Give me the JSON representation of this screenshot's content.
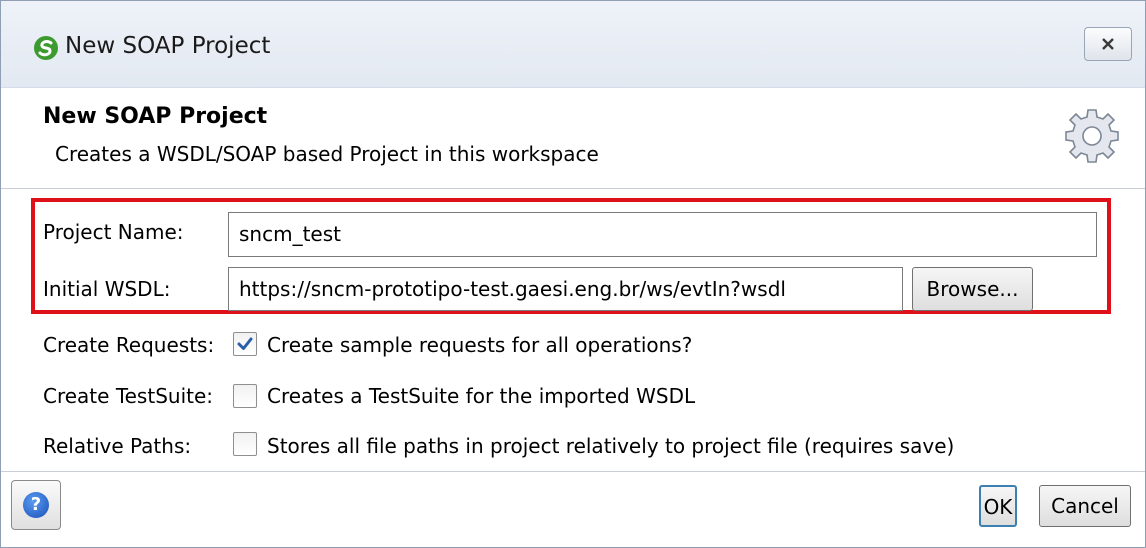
{
  "window": {
    "title": "New SOAP Project",
    "close_icon": "close-icon",
    "app_icon": "soapui-icon"
  },
  "header": {
    "title": "New SOAP Project",
    "subtitle": "Creates a WSDL/SOAP based Project in this workspace",
    "icon": "gear-icon"
  },
  "form": {
    "project_name": {
      "label": "Project Name:",
      "value": "sncm_test"
    },
    "initial_wsdl": {
      "label": "Initial WSDL:",
      "value": "https://sncm-prototipo-test.gaesi.eng.br/ws/evtIn?wsdl",
      "browse_label": "Browse..."
    },
    "create_requests": {
      "label": "Create Requests:",
      "checkbox_label": "Create sample requests for all operations?",
      "checked": true
    },
    "create_testsuite": {
      "label": "Create TestSuite:",
      "checkbox_label": "Creates a TestSuite for the imported WSDL",
      "checked": false
    },
    "relative_paths": {
      "label": "Relative Paths:",
      "checkbox_label": "Stores all file paths in project relatively to project file (requires save)",
      "checked": false
    }
  },
  "footer": {
    "help_icon": "help-icon",
    "help_symbol": "?",
    "ok_label": "OK",
    "cancel_label": "Cancel"
  },
  "colors": {
    "highlight": "#e0101a",
    "title_bar": "#e9eef5"
  }
}
